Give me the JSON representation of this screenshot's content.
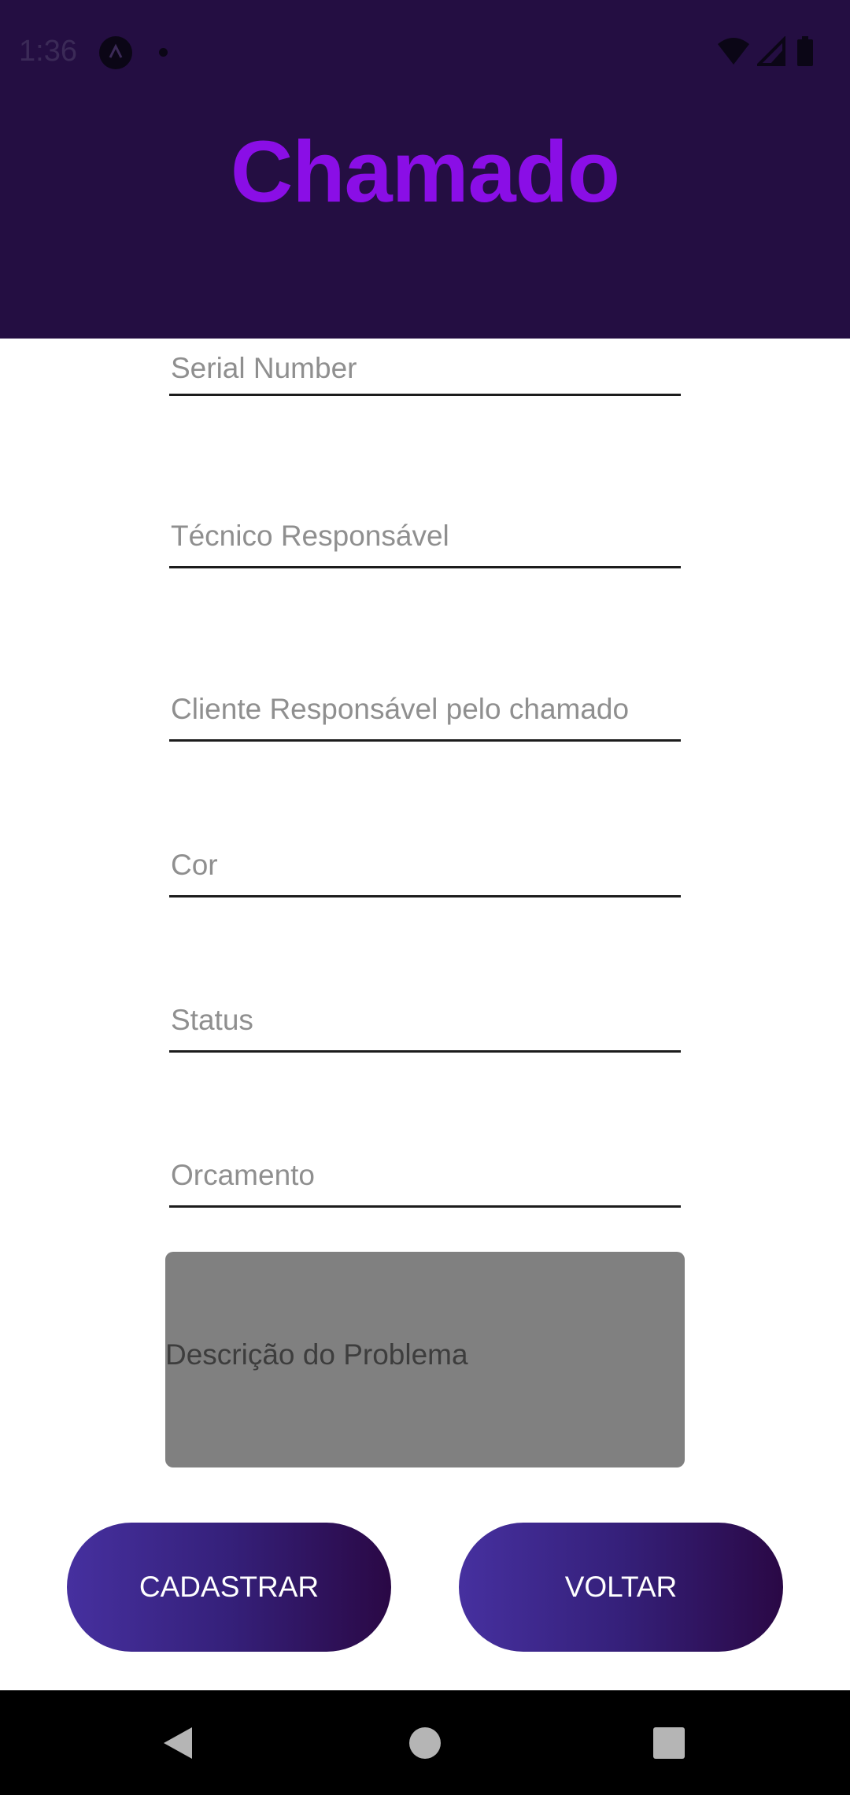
{
  "status_bar": {
    "time": "1:36",
    "icons": [
      "app-notification-icon",
      "dot-icon",
      "wifi-icon",
      "signal-icon",
      "battery-icon"
    ]
  },
  "header": {
    "title": "Chamado",
    "background_color": "#240e42",
    "title_color": "#8a0ee6"
  },
  "form": {
    "fields": [
      {
        "placeholder": "Serial Number",
        "value": ""
      },
      {
        "placeholder": "Técnico Responsável",
        "value": ""
      },
      {
        "placeholder": "Cliente Responsável pelo chamado",
        "value": ""
      },
      {
        "placeholder": "Cor",
        "value": ""
      },
      {
        "placeholder": "Status",
        "value": ""
      },
      {
        "placeholder": "Orcamento",
        "value": ""
      }
    ],
    "description": {
      "placeholder": "Descrição do Problema",
      "value": ""
    }
  },
  "buttons": {
    "register_label": "CADASTRAR",
    "back_label": "VOLTAR"
  },
  "nav_bar": {
    "icons": [
      "back-icon",
      "home-icon",
      "recents-icon"
    ]
  }
}
